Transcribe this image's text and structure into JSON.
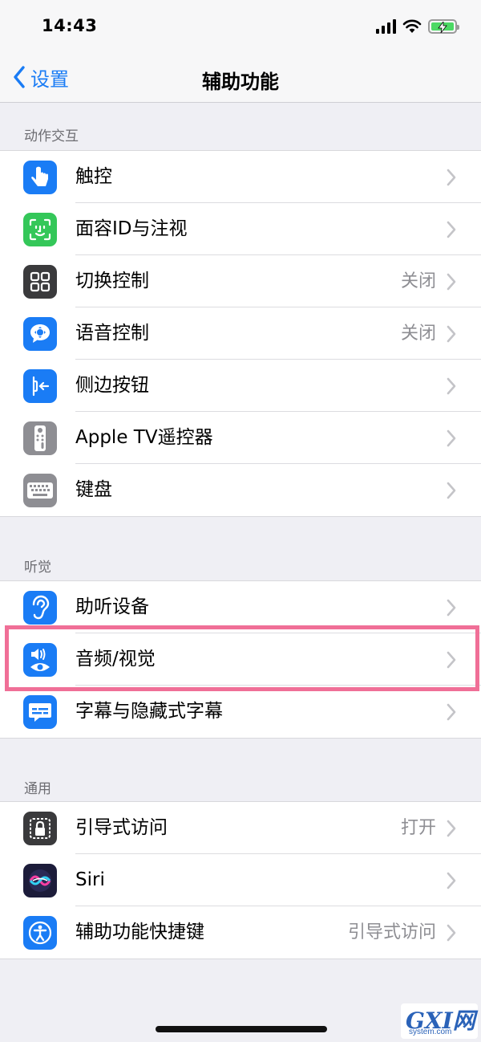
{
  "status_bar": {
    "time": "14:43"
  },
  "nav": {
    "back_label": "设置",
    "title": "辅助功能"
  },
  "sections": [
    {
      "header": "动作交互",
      "rows": [
        {
          "label": "触控",
          "value": "",
          "icon": "touch-icon",
          "color": "#1a7cf5"
        },
        {
          "label": "面容ID与注视",
          "value": "",
          "icon": "face-id-icon",
          "color": "#34c759"
        },
        {
          "label": "切换控制",
          "value": "关闭",
          "icon": "switch-control-icon",
          "color": "#3a3a3c"
        },
        {
          "label": "语音控制",
          "value": "关闭",
          "icon": "voice-control-icon",
          "color": "#1a7cf5"
        },
        {
          "label": "侧边按钮",
          "value": "",
          "icon": "side-button-icon",
          "color": "#1a7cf5"
        },
        {
          "label": "Apple TV遥控器",
          "value": "",
          "icon": "remote-icon",
          "color": "#8e8e93"
        },
        {
          "label": "键盘",
          "value": "",
          "icon": "keyboard-icon",
          "color": "#8e8e93"
        }
      ]
    },
    {
      "header": "听觉",
      "rows": [
        {
          "label": "助听设备",
          "value": "",
          "icon": "ear-icon",
          "color": "#1a7cf5"
        },
        {
          "label": "音频/视觉",
          "value": "",
          "icon": "audio-visual-icon",
          "color": "#1a7cf5"
        },
        {
          "label": "字幕与隐藏式字幕",
          "value": "",
          "icon": "subtitles-icon",
          "color": "#1a7cf5"
        }
      ]
    },
    {
      "header": "通用",
      "rows": [
        {
          "label": "引导式访问",
          "value": "打开",
          "icon": "guided-access-icon",
          "color": "#3a3a3c"
        },
        {
          "label": "Siri",
          "value": "",
          "icon": "siri-icon",
          "color": "#1c1c3a"
        },
        {
          "label": "辅助功能快捷键",
          "value": "引导式访问",
          "icon": "accessibility-icon",
          "color": "#1a7cf5"
        }
      ]
    }
  ],
  "watermark": {
    "main": "GXI网",
    "sub": "system.com"
  }
}
